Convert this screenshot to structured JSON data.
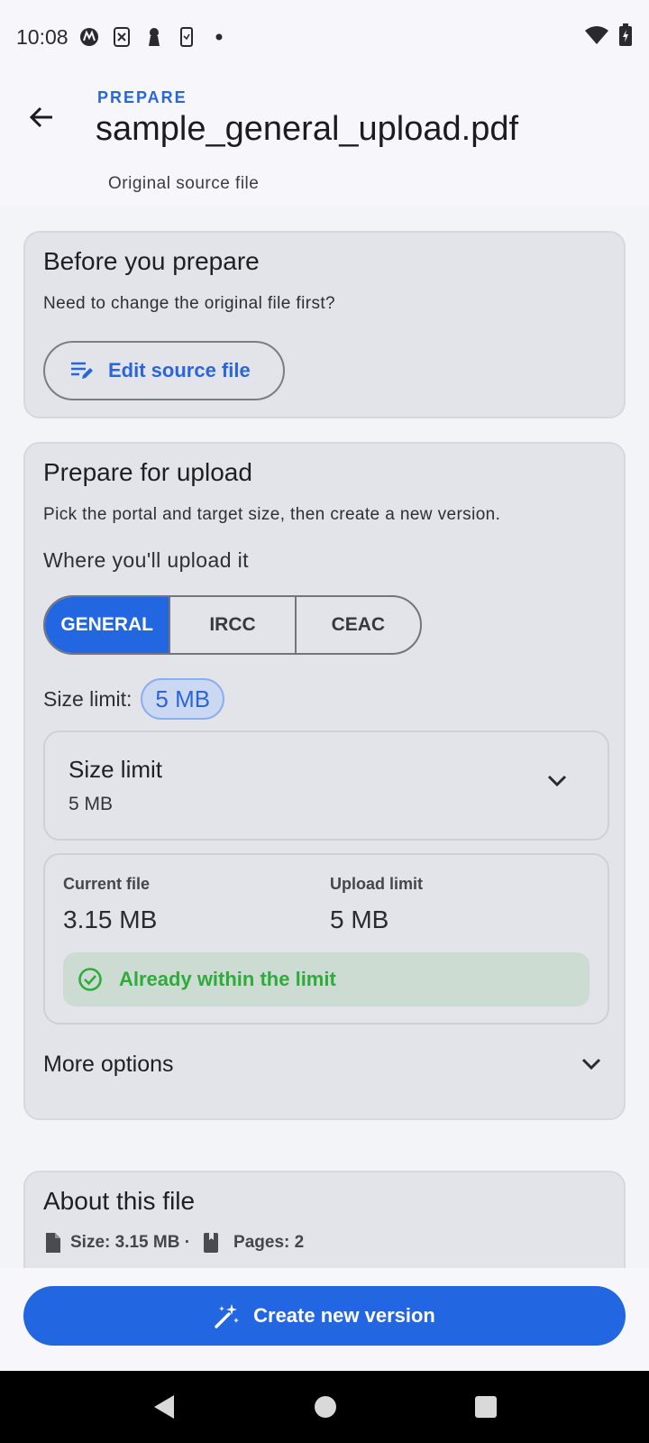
{
  "status_bar": {
    "time": "10:08",
    "icons": [
      "motorola-icon",
      "sim-icon",
      "keyhole-icon",
      "phone-icon",
      "dot-icon"
    ],
    "right_icons": [
      "wifi-icon",
      "battery-icon"
    ]
  },
  "app_bar": {
    "overline": "PREPARE",
    "title": "sample_general_upload.pdf",
    "subtitle": "Original source file"
  },
  "before_card": {
    "title": "Before you prepare",
    "text": "Need to change the original file first?",
    "button_label": "Edit source file"
  },
  "prepare_card": {
    "title": "Prepare for upload",
    "text": "Pick the portal and target size, then create a new version.",
    "where_label": "Where you'll upload it",
    "portals": [
      {
        "label": "GENERAL",
        "selected": true
      },
      {
        "label": "IRCC",
        "selected": false
      },
      {
        "label": "CEAC",
        "selected": false
      }
    ],
    "size_limit_label": "Size limit:",
    "size_limit_chip": "5 MB",
    "dropdown": {
      "label": "Size limit",
      "value": "5 MB"
    },
    "current_file_label": "Current file",
    "current_file_value": "3.15 MB",
    "upload_limit_label": "Upload limit",
    "upload_limit_value": "5 MB",
    "status_message": "Already within the limit",
    "more_options": "More options"
  },
  "about_card": {
    "title": "About this file",
    "size_text": "Size: 3.15 MB ·",
    "pages_text": "Pages: 2"
  },
  "primary_action": {
    "label": "Create new version"
  },
  "colors": {
    "accent": "#2366e1",
    "success": "#2fab3c",
    "card_bg": "#e3e4ea"
  }
}
